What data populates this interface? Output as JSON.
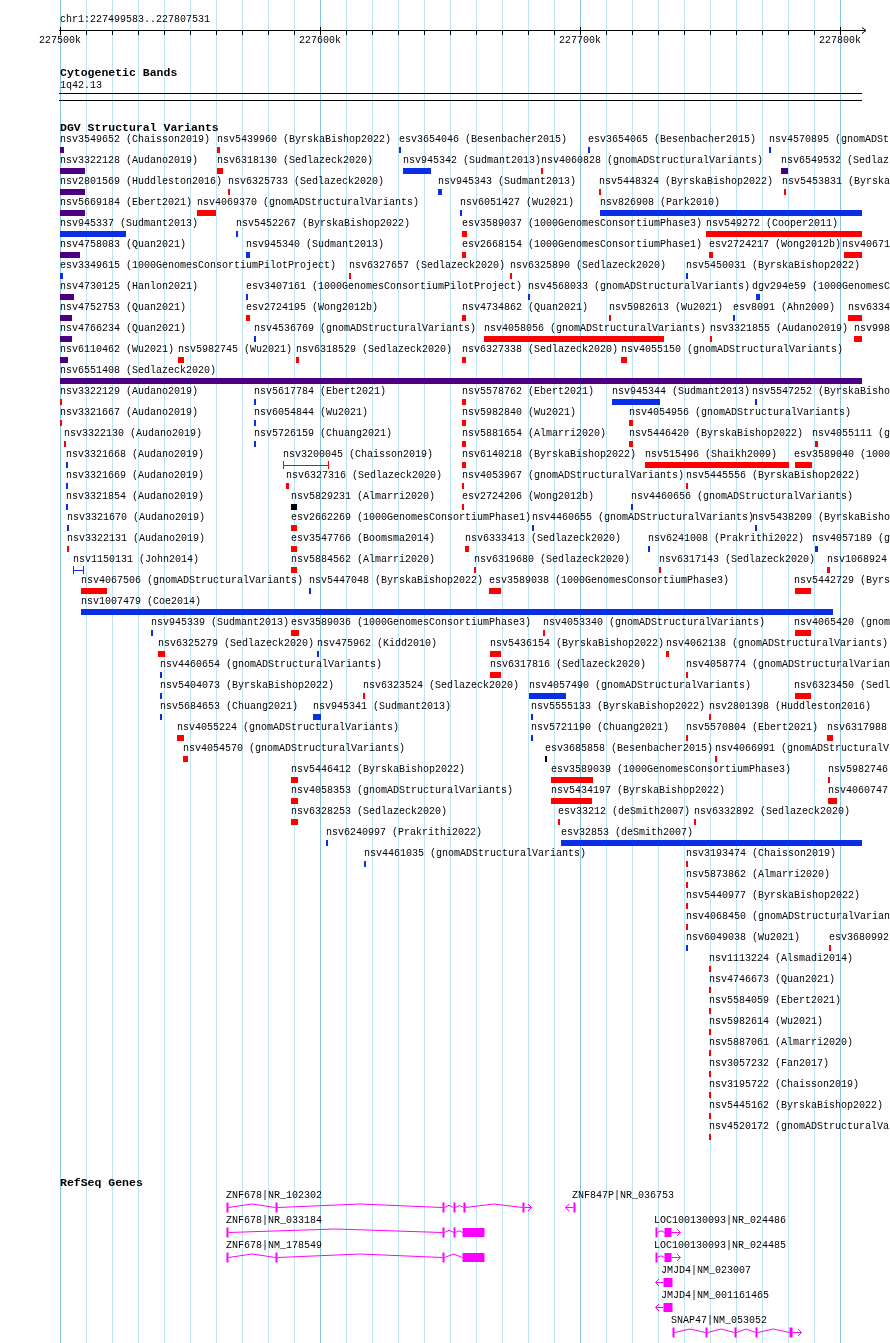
{
  "ruler": {
    "location": "chr1:227499583..227807531",
    "ticks": [
      "227500k",
      "227600k",
      "227700k",
      "227800k"
    ]
  },
  "cytoband_track": {
    "title": "Cytogenetic Bands",
    "band": "1q42.13"
  },
  "variant_track": {
    "title": "DGV Structural Variants",
    "features": [
      {
        "label": "nsv3549652 (Chaisson2019)",
        "kind": "bar",
        "color": "#4b0082"
      },
      {
        "label": "nsv5439960 (ByrskaBishop2022)",
        "kind": "bar",
        "color": "#ff0000"
      },
      {
        "label": "esv3654046 (Besenbacher2015)",
        "kind": "bar",
        "color": "#0a2de8"
      },
      {
        "label": "esv3654065 (Besenbacher2015)",
        "kind": "bar",
        "color": "#0a2de8"
      },
      {
        "label": "nsv4570895 (gnomADSt",
        "kind": "bar",
        "color": "#0a2de8"
      },
      {
        "label": "nsv3322128 (Audano2019)",
        "kind": "bar",
        "color": "#4b0082"
      },
      {
        "label": "nsv6318130 (Sedlazeck2020)",
        "kind": "bar",
        "color": "#ff0000"
      },
      {
        "label": "nsv945342 (Sudmant2013)",
        "kind": "bar",
        "color": "#0a2de8"
      },
      {
        "label": "nsv4060828 (gnomADStructuralVariants)",
        "kind": "bar",
        "color": "#ff0000"
      },
      {
        "label": "nsv6549532 (Sedlaz",
        "kind": "bar",
        "color": "#4b0082"
      },
      {
        "label": "nsv2801569 (Huddleston2016)",
        "kind": "bar",
        "color": "#4b0082"
      },
      {
        "label": "nsv6325733 (Sedlazeck2020)",
        "kind": "bar",
        "color": "#ff0000"
      },
      {
        "label": "nsv945343 (Sudmant2013)",
        "kind": "bar",
        "color": "#0a2de8"
      },
      {
        "label": "nsv5448324 (ByrskaBishop2022)",
        "kind": "bar",
        "color": "#ff0000"
      },
      {
        "label": "nsv5453831 (Byrska",
        "kind": "bar",
        "color": "#ff0000"
      },
      {
        "label": "nsv5669184 (Ebert2021)",
        "kind": "bar",
        "color": "#4b0082"
      },
      {
        "label": "nsv4069370 (gnomADStructuralVariants)",
        "kind": "bar",
        "color": "#ff0000"
      },
      {
        "label": "nsv6051427 (Wu2021)",
        "kind": "bar",
        "color": "#0a2de8"
      },
      {
        "label": "nsv826908 (Park2010)",
        "kind": "bar",
        "color": "#0a2de8"
      },
      {
        "label": "nsv945337 (Sudmant2013)",
        "kind": "bar",
        "color": "#0a2de8"
      },
      {
        "label": "nsv5452267 (ByrskaBishop2022)",
        "kind": "bar",
        "color": "#0a2de8"
      },
      {
        "label": "esv3589037 (1000GenomesConsortiumPhase3)",
        "kind": "bar",
        "color": "#ff0000"
      },
      {
        "label": "nsv549272 (Cooper2011)",
        "kind": "bar",
        "color": "#ff0000"
      },
      {
        "label": "nsv4758083 (Quan2021)",
        "kind": "bar",
        "color": "#4b0082"
      },
      {
        "label": "nsv945340 (Sudmant2013)",
        "kind": "bar",
        "color": "#0a2de8"
      },
      {
        "label": "esv2668154 (1000GenomesConsortiumPhase1)",
        "kind": "bar",
        "color": "#ff0000"
      },
      {
        "label": "esv2724217 (Wong2012b)",
        "kind": "bar",
        "color": "#ff0000"
      },
      {
        "label": "nsv40671",
        "kind": "bar",
        "color": "#ff0000"
      },
      {
        "label": "esv3349615 (1000GenomesConsortiumPilotProject)",
        "kind": "bar",
        "color": "#0a2de8"
      },
      {
        "label": "nsv6327657 (Sedlazeck2020)",
        "kind": "bar",
        "color": "#ff0000"
      },
      {
        "label": "nsv6325890 (Sedlazeck2020)",
        "kind": "bar",
        "color": "#ff0000"
      },
      {
        "label": "nsv5450031 (ByrskaBishop2022)",
        "kind": "bar",
        "color": "#0a2de8"
      },
      {
        "label": "nsv4730125 (Hanlon2021)",
        "kind": "bar",
        "color": "#4b0082"
      },
      {
        "label": "esv3407161 (1000GenomesConsortiumPilotProject)",
        "kind": "bar",
        "color": "#0a2de8"
      },
      {
        "label": "nsv4568033 (gnomADStructuralVariants)",
        "kind": "bar",
        "color": "#0a2de8"
      },
      {
        "label": "dgv294e59 (1000GenomesC",
        "kind": "bar",
        "color": "#0a2de8"
      },
      {
        "label": "nsv4752753 (Quan2021)",
        "kind": "bar",
        "color": "#4b0082"
      },
      {
        "label": "esv2724195 (Wong2012b)",
        "kind": "bar",
        "color": "#ff0000"
      },
      {
        "label": "nsv4734862 (Quan2021)",
        "kind": "bar",
        "color": "#ff0000"
      },
      {
        "label": "nsv5982613 (Wu2021)",
        "kind": "bar",
        "color": "#ff0000"
      },
      {
        "label": "esv8091 (Ahn2009)",
        "kind": "bar",
        "color": "#0a2de8"
      },
      {
        "label": "nsv6334",
        "kind": "bar",
        "color": "#ff0000"
      },
      {
        "label": "nsv4766234 (Quan2021)",
        "kind": "bar",
        "color": "#4b0082"
      },
      {
        "label": "nsv4536769 (gnomADStructuralVariants)",
        "kind": "bar",
        "color": "#0a2de8"
      },
      {
        "label": "nsv4058056 (gnomADStructuralVariants)",
        "kind": "bar",
        "color": "#ff0000"
      },
      {
        "label": "nsv3321855 (Audano2019)",
        "kind": "bar",
        "color": "#ff0000"
      },
      {
        "label": "nsv998",
        "kind": "bar",
        "color": "#ff0000"
      },
      {
        "label": "nsv6110462 (Wu2021)",
        "kind": "bar",
        "color": "#4b0082"
      },
      {
        "label": "nsv5982745 (Wu2021)",
        "kind": "bar",
        "color": "#ff0000"
      },
      {
        "label": "nsv6318529 (Sedlazeck2020)",
        "kind": "bar",
        "color": "#ff0000"
      },
      {
        "label": "nsv6327338 (Sedlazeck2020)",
        "kind": "bar",
        "color": "#ff0000"
      },
      {
        "label": "nsv4055150 (gnomADStructuralVariants)",
        "kind": "bar",
        "color": "#ff0000"
      },
      {
        "label": "nsv6551408 (Sedlazeck2020)",
        "kind": "bar",
        "color": "#4b0082"
      },
      {
        "label": "nsv3322129 (Audano2019)",
        "kind": "bar",
        "color": "#ff0000"
      },
      {
        "label": "nsv5617784 (Ebert2021)",
        "kind": "bar",
        "color": "#0a2de8"
      },
      {
        "label": "nsv5578762 (Ebert2021)",
        "kind": "bar",
        "color": "#ff0000"
      },
      {
        "label": "nsv945344 (Sudmant2013)",
        "kind": "bar",
        "color": "#0a2de8"
      },
      {
        "label": "nsv5547252 (ByrskaBisho",
        "kind": "bar",
        "color": "#0a2de8"
      },
      {
        "label": "nsv3321667 (Audano2019)",
        "kind": "bar",
        "color": "#ff0000"
      },
      {
        "label": "nsv6054844 (Wu2021)",
        "kind": "bar",
        "color": "#0a2de8"
      },
      {
        "label": "nsv5982840 (Wu2021)",
        "kind": "bar",
        "color": "#ff0000"
      },
      {
        "label": "nsv4054956 (gnomADStructuralVariants)",
        "kind": "bar",
        "color": "#ff0000"
      },
      {
        "label": "nsv3322130 (Audano2019)",
        "kind": "bar",
        "color": "#ff0000"
      },
      {
        "label": "nsv5726159 (Chuang2021)",
        "kind": "bar",
        "color": "#0a2de8"
      },
      {
        "label": "nsv5881654 (Almarri2020)",
        "kind": "bar",
        "color": "#ff0000"
      },
      {
        "label": "nsv5446420 (ByrskaBishop2022)",
        "kind": "bar",
        "color": "#ff0000"
      },
      {
        "label": "nsv4055111 (g",
        "kind": "bar",
        "color": "#ff0000"
      },
      {
        "label": "nsv3321668 (Audano2019)",
        "kind": "bar",
        "color": "#0a2de8"
      },
      {
        "label": "nsv3200045 (Chaisson2019)",
        "kind": "span",
        "color": "#ff0000"
      },
      {
        "label": "nsv6140218 (ByrskaBishop2022)",
        "kind": "bar",
        "color": "#ff0000"
      },
      {
        "label": "nsv515496 (Shaikh2009)",
        "kind": "bar",
        "color": "#ff0000"
      },
      {
        "label": "esv3589040 (1000",
        "kind": "bar",
        "color": "#ff0000"
      },
      {
        "label": "nsv3321669 (Audano2019)",
        "kind": "bar",
        "color": "#0a2de8"
      },
      {
        "label": "nsv6327316 (Sedlazeck2020)",
        "kind": "bar",
        "color": "#ff0000"
      },
      {
        "label": "nsv4053967 (gnomADStructuralVariants)",
        "kind": "bar",
        "color": "#ff0000"
      },
      {
        "label": "nsv5445556 (ByrskaBishop2022)",
        "kind": "bar",
        "color": "#ff0000"
      },
      {
        "label": "nsv3321854 (Audano2019)",
        "kind": "bar",
        "color": "#0a2de8"
      },
      {
        "label": "nsv5829231 (Almarri2020)",
        "kind": "bar",
        "color": "#000000"
      },
      {
        "label": "esv2724206 (Wong2012b)",
        "kind": "bar",
        "color": "#ff0000"
      },
      {
        "label": "nsv4460656 (gnomADStructuralVariants)",
        "kind": "bar",
        "color": "#0a2de8"
      },
      {
        "label": "nsv3321670 (Audano2019)",
        "kind": "bar",
        "color": "#0a2de8"
      },
      {
        "label": "esv2662269 (1000GenomesConsortiumPhase1)",
        "kind": "bar",
        "color": "#ff0000"
      },
      {
        "label": "nsv4460655 (gnomADStructuralVariants)",
        "kind": "bar",
        "color": "#0a2de8"
      },
      {
        "label": "nsv5438209 (ByrskaBisho",
        "kind": "bar",
        "color": "#0a2de8"
      },
      {
        "label": "nsv3322131 (Audano2019)",
        "kind": "bar",
        "color": "#ff0000"
      },
      {
        "label": "esv3547766 (Boomsma2014)",
        "kind": "bar",
        "color": "#ff0000"
      },
      {
        "label": "nsv6333413 (Sedlazeck2020)",
        "kind": "bar",
        "color": "#ff0000"
      },
      {
        "label": "nsv6241008 (Prakrithi2022)",
        "kind": "bar",
        "color": "#0a2de8"
      },
      {
        "label": "nsv4057189 (g",
        "kind": "bar",
        "color": "#0a2de8"
      },
      {
        "label": "nsv1150131 (John2014)",
        "kind": "span",
        "color": "#0a2de8"
      },
      {
        "label": "nsv5884562 (Almarri2020)",
        "kind": "bar",
        "color": "#ff0000"
      },
      {
        "label": "nsv6319680 (Sedlazeck2020)",
        "kind": "bar",
        "color": "#ff0000"
      },
      {
        "label": "nsv6317143 (Sedlazeck2020)",
        "kind": "bar",
        "color": "#ff0000"
      },
      {
        "label": "nsv1068924",
        "kind": "bar",
        "color": "#ff0000"
      },
      {
        "label": "nsv4067506 (gnomADStructuralVariants)",
        "kind": "bar",
        "color": "#ff0000"
      },
      {
        "label": "nsv5447048 (ByrskaBishop2022)",
        "kind": "bar",
        "color": "#0a2de8"
      },
      {
        "label": "esv3589038 (1000GenomesConsortiumPhase3)",
        "kind": "bar",
        "color": "#ff0000"
      },
      {
        "label": "nsv5442729 (Byrs",
        "kind": "bar",
        "color": "#ff0000"
      },
      {
        "label": "nsv1007479 (Coe2014)",
        "kind": "bar",
        "color": "#0a2de8"
      },
      {
        "label": "nsv945339 (Sudmant2013)",
        "kind": "bar",
        "color": "#0a2de8"
      },
      {
        "label": "esv3589036 (1000GenomesConsortiumPhase3)",
        "kind": "bar",
        "color": "#ff0000"
      },
      {
        "label": "nsv4053340 (gnomADStructuralVariants)",
        "kind": "bar",
        "color": "#ff0000"
      },
      {
        "label": "nsv4065420 (gnom",
        "kind": "bar",
        "color": "#ff0000"
      },
      {
        "label": "nsv6325279 (Sedlazeck2020)",
        "kind": "bar",
        "color": "#ff0000"
      },
      {
        "label": "nsv475962 (Kidd2010)",
        "kind": "bar",
        "color": "#0a2de8"
      },
      {
        "label": "nsv5436154 (ByrskaBishop2022)",
        "kind": "bar",
        "color": "#ff0000"
      },
      {
        "label": "nsv4062138 (gnomADStructuralVariants)",
        "kind": "bar",
        "color": "#ff0000"
      },
      {
        "label": "nsv4460654 (gnomADStructuralVariants)",
        "kind": "bar",
        "color": "#0a2de8"
      },
      {
        "label": "nsv6317816 (Sedlazeck2020)",
        "kind": "bar",
        "color": "#ff0000"
      },
      {
        "label": "nsv4058774 (gnomADStructuralVarian",
        "kind": "bar",
        "color": "#ff0000"
      },
      {
        "label": "nsv5404073 (ByrskaBishop2022)",
        "kind": "bar",
        "color": "#0a2de8"
      },
      {
        "label": "nsv6323524 (Sedlazeck2020)",
        "kind": "bar",
        "color": "#ff0000"
      },
      {
        "label": "nsv4057490 (gnomADStructuralVariants)",
        "kind": "bar",
        "color": "#0a2de8"
      },
      {
        "label": "nsv6323450 (Sedl",
        "kind": "bar",
        "color": "#ff0000"
      },
      {
        "label": "nsv5684653 (Chuang2021)",
        "kind": "bar",
        "color": "#0a2de8"
      },
      {
        "label": "nsv945341 (Sudmant2013)",
        "kind": "bar",
        "color": "#0a2de8"
      },
      {
        "label": "nsv5555133 (ByrskaBishop2022)",
        "kind": "bar",
        "color": "#0a2de8"
      },
      {
        "label": "nsv2801398 (Huddleston2016)",
        "kind": "bar",
        "color": "#ff0000"
      },
      {
        "label": "nsv4055224 (gnomADStructuralVariants)",
        "kind": "bar",
        "color": "#ff0000"
      },
      {
        "label": "nsv5721190 (Chuang2021)",
        "kind": "bar",
        "color": "#0a2de8"
      },
      {
        "label": "nsv5570804 (Ebert2021)",
        "kind": "bar",
        "color": "#ff0000"
      },
      {
        "label": "nsv6317988",
        "kind": "bar",
        "color": "#ff0000"
      },
      {
        "label": "nsv4054570 (gnomADStructuralVariants)",
        "kind": "bar",
        "color": "#ff0000"
      },
      {
        "label": "esv3685858 (Besenbacher2015)",
        "kind": "bar",
        "color": "#000000"
      },
      {
        "label": "nsv4066991 (gnomADStructuralV",
        "kind": "bar",
        "color": "#ff0000"
      },
      {
        "label": "nsv5446412 (ByrskaBishop2022)",
        "kind": "bar",
        "color": "#ff0000"
      },
      {
        "label": "esv3589039 (1000GenomesConsortiumPhase3)",
        "kind": "bar",
        "color": "#ff0000"
      },
      {
        "label": "nsv5982746",
        "kind": "bar",
        "color": "#ff0000"
      },
      {
        "label": "nsv4058353 (gnomADStructuralVariants)",
        "kind": "bar",
        "color": "#ff0000"
      },
      {
        "label": "nsv5434197 (ByrskaBishop2022)",
        "kind": "bar",
        "color": "#ff0000"
      },
      {
        "label": "nsv4060747",
        "kind": "bar",
        "color": "#ff0000"
      },
      {
        "label": "nsv6328253 (Sedlazeck2020)",
        "kind": "bar",
        "color": "#ff0000"
      },
      {
        "label": "esv33212 (deSmith2007)",
        "kind": "bar",
        "color": "#ff0000"
      },
      {
        "label": "nsv6332892 (Sedlazeck2020)",
        "kind": "bar",
        "color": "#ff0000"
      },
      {
        "label": "nsv6240997 (Prakrithi2022)",
        "kind": "bar",
        "color": "#0a2de8"
      },
      {
        "label": "esv32853 (deSmith2007)",
        "kind": "bar",
        "color": "#0a2de8"
      },
      {
        "label": "nsv4461035 (gnomADStructuralVariants)",
        "kind": "bar",
        "color": "#0a2de8"
      },
      {
        "label": "nsv3193474 (Chaisson2019)",
        "kind": "bar",
        "color": "#ff0000"
      },
      {
        "label": "nsv5873862 (Almarri2020)",
        "kind": "bar",
        "color": "#ff0000"
      },
      {
        "label": "nsv5440977 (ByrskaBishop2022)",
        "kind": "bar",
        "color": "#ff0000"
      },
      {
        "label": "nsv4068450 (gnomADStructuralVarian",
        "kind": "bar",
        "color": "#ff0000"
      },
      {
        "label": "nsv6049038 (Wu2021)",
        "kind": "bar",
        "color": "#0a2de8"
      },
      {
        "label": "esv3680992",
        "kind": "bar",
        "color": "#ff0000"
      },
      {
        "label": "nsv1113224 (Alsmadi2014)",
        "kind": "bar",
        "color": "#ff0000"
      },
      {
        "label": "nsv4746673 (Quan2021)",
        "kind": "bar",
        "color": "#ff0000"
      },
      {
        "label": "nsv5584059 (Ebert2021)",
        "kind": "bar",
        "color": "#ff0000"
      },
      {
        "label": "nsv5982614 (Wu2021)",
        "kind": "bar",
        "color": "#ff0000"
      },
      {
        "label": "nsv5887061 (Almarri2020)",
        "kind": "bar",
        "color": "#ff0000"
      },
      {
        "label": "nsv3057232 (Fan2017)",
        "kind": "bar",
        "color": "#ff0000"
      },
      {
        "label": "nsv3195722 (Chaisson2019)",
        "kind": "bar",
        "color": "#ff0000"
      },
      {
        "label": "nsv5445162 (ByrskaBishop2022)",
        "kind": "bar",
        "color": "#ff0000"
      },
      {
        "label": "nsv4520172 (gnomADStructuralVa",
        "kind": "bar",
        "color": "#ff0000"
      }
    ]
  },
  "gene_track": {
    "title": "RefSeq Genes",
    "genes": [
      {
        "label": "ZNF678|NR_102302"
      },
      {
        "label": "ZNF847P|NR_036753"
      },
      {
        "label": "ZNF678|NR_033184"
      },
      {
        "label": "LOC100130093|NR_024486"
      },
      {
        "label": "ZNF678|NM_178549"
      },
      {
        "label": "LOC100130093|NR_024485"
      },
      {
        "label": "JMJD4|NM_023007"
      },
      {
        "label": "JMJD4|NM_001161465"
      },
      {
        "label": "SNAP47|NM_053052"
      }
    ]
  }
}
